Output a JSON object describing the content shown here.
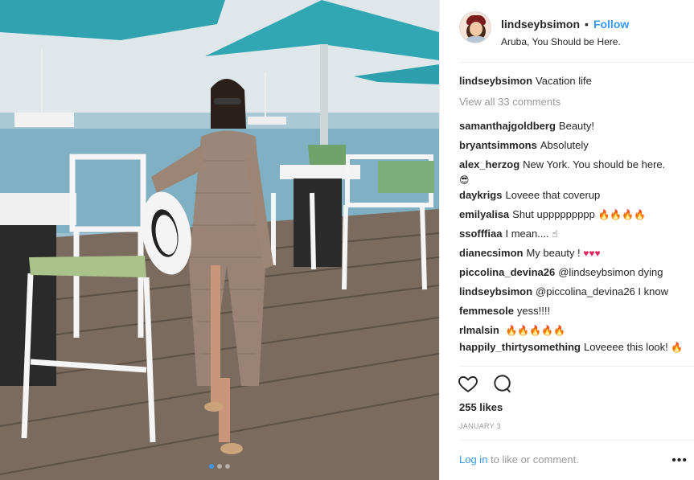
{
  "post": {
    "username": "lindseybsimon",
    "bullet": "•",
    "follow_label": "Follow",
    "location": "Aruba, You Should be Here.",
    "caption": {
      "user": "lindseybsimon",
      "text": "Vacation life"
    },
    "view_all": "View all 33 comments",
    "comments": [
      {
        "user": "samanthajgoldberg",
        "text": "Beauty!"
      },
      {
        "user": "bryantsimmons",
        "text": "Absolutely"
      },
      {
        "user": "alex_herzog",
        "text": "New York. You should be here."
      },
      {
        "user": "daykrigs",
        "text": "Loveee that coverup"
      },
      {
        "user": "emilyalisa",
        "text": "Shut uppppppppp"
      },
      {
        "user": "ssofffiaa",
        "text": "I mean...."
      },
      {
        "user": "dianecsimon",
        "text": "My beauty !"
      },
      {
        "user": "piccolina_devina26",
        "text": "@lindseybsimon dying"
      },
      {
        "user": "lindseybsimon",
        "text": "@piccolina_devina26 I know"
      },
      {
        "user": "femmesole",
        "text": "yess!!!!"
      },
      {
        "user": "rlmalsin",
        "text": ""
      },
      {
        "user": "happily_thirtysomething",
        "text": "Loveeee this look!"
      }
    ],
    "likes": "255 likes",
    "date": "JANUARY 3",
    "login_link": "Log in",
    "login_text": " to like or comment.",
    "more": "•••"
  },
  "icons": {
    "like": "heart-outline-icon",
    "comment": "speech-bubble-icon"
  },
  "colors": {
    "link_blue": "#3897f0",
    "muted": "#999999",
    "text": "#262626"
  },
  "carousel": {
    "count": 3,
    "active": 1
  }
}
